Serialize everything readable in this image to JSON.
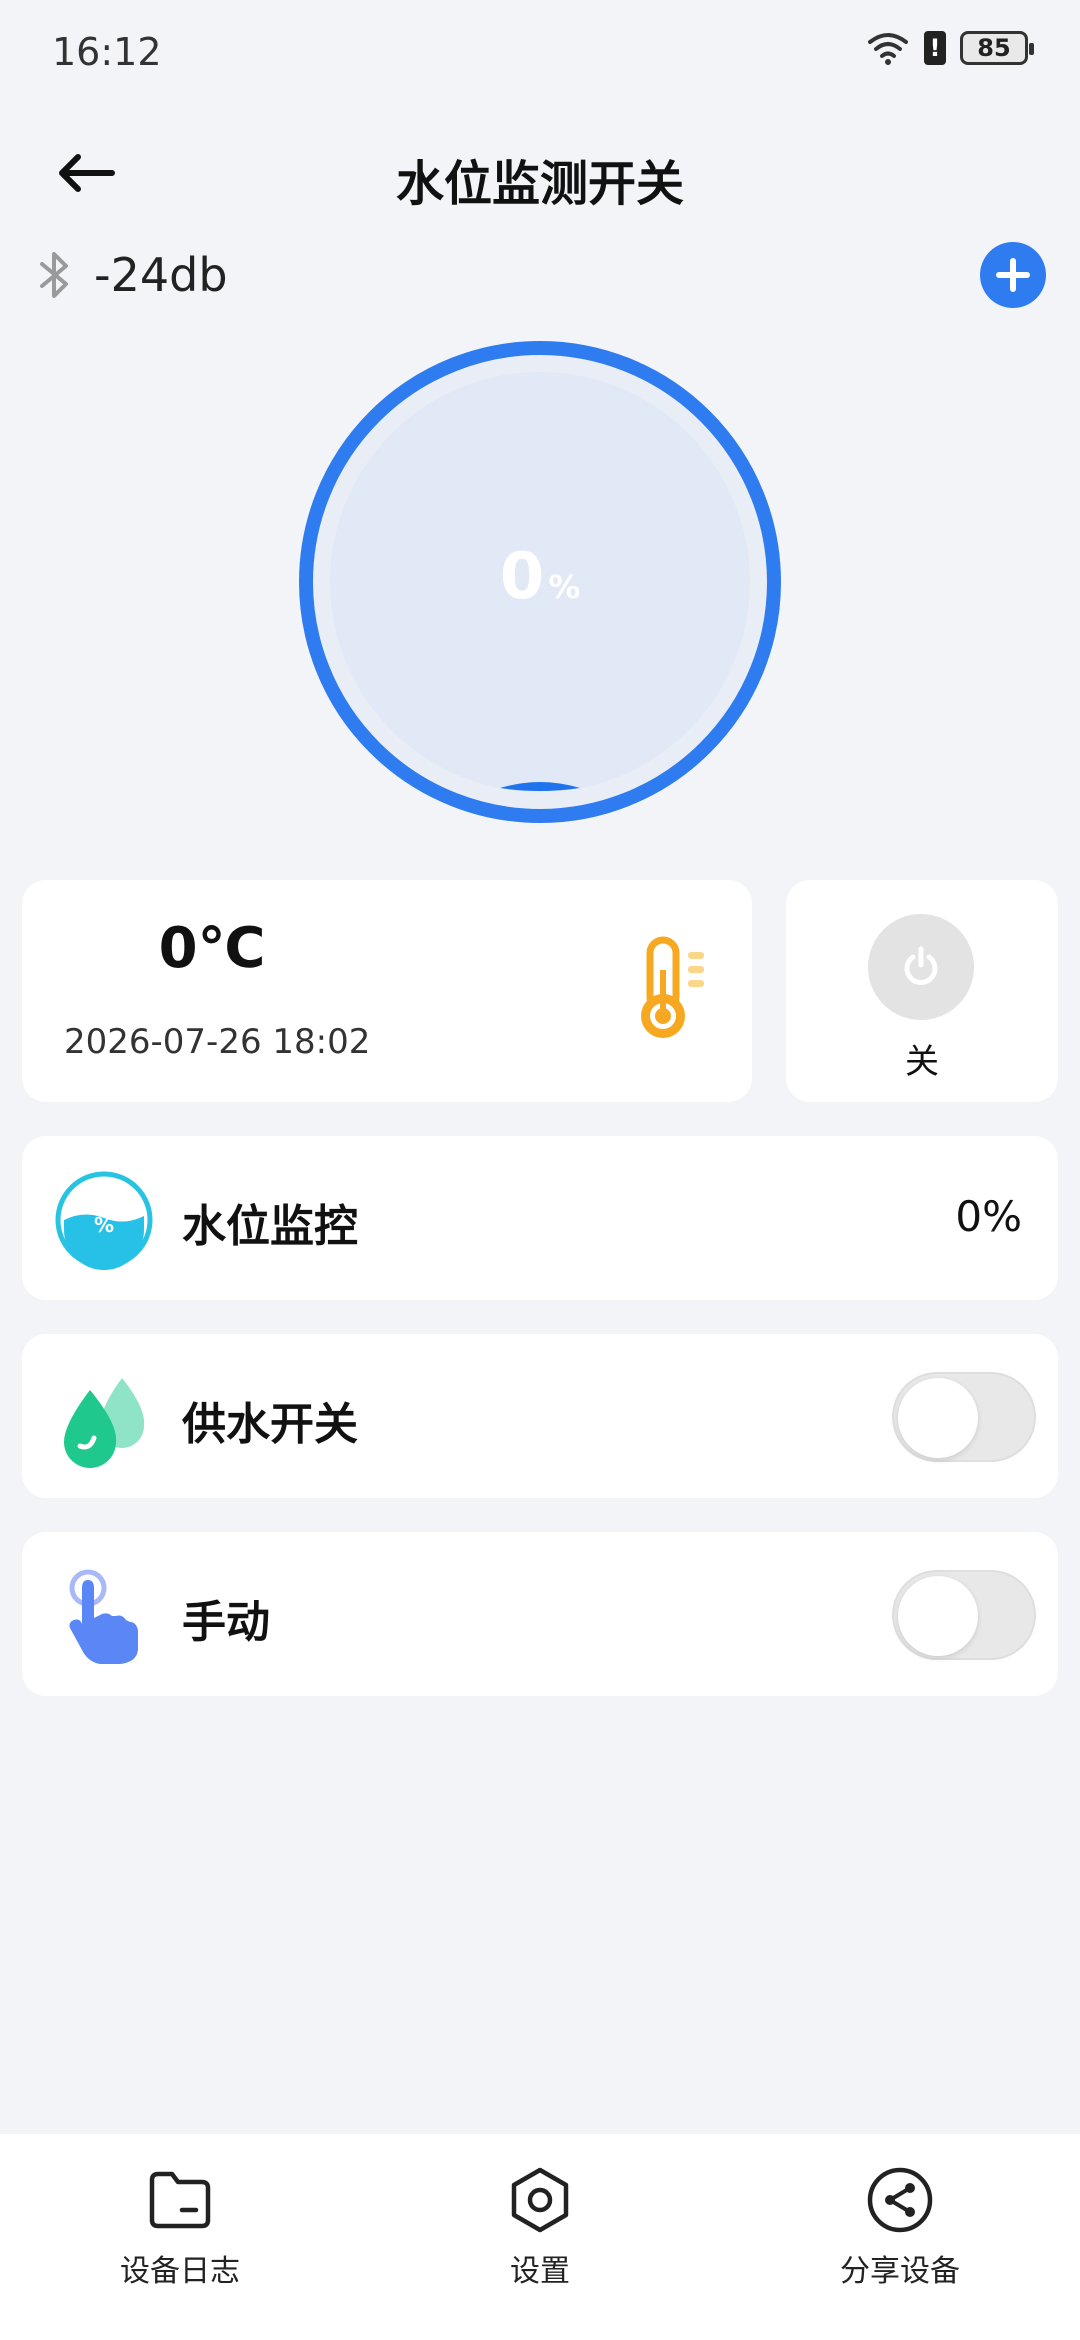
{
  "status_bar": {
    "time": "16:12",
    "battery": "85",
    "alert": "!"
  },
  "header": {
    "title": "水位监测开关"
  },
  "signal": {
    "value": "-24db"
  },
  "gauge": {
    "value": "0",
    "unit": "%",
    "level_fraction": 0,
    "ring_color": "#2f7cf1",
    "fill_color": "#e1e9f7"
  },
  "temperature": {
    "value": "0℃",
    "timestamp": "2026-07-26 18:02",
    "icon": "thermometer-icon",
    "color": "#f6a821"
  },
  "power": {
    "label": "关",
    "icon": "power-icon"
  },
  "rows": {
    "level": {
      "label": "水位监控",
      "value": "0%",
      "icon": "water-level-icon",
      "badge": "%"
    },
    "supply": {
      "label": "供水开关",
      "icon": "water-drops-icon",
      "on": false
    },
    "manual": {
      "label": "手动",
      "icon": "hand-tap-icon",
      "on": false
    }
  },
  "bottom_nav": {
    "log": {
      "label": "设备日志",
      "icon": "folder-icon"
    },
    "settings": {
      "label": "设置",
      "icon": "hexagon-settings-icon"
    },
    "share": {
      "label": "分享设备",
      "icon": "share-icon"
    }
  }
}
